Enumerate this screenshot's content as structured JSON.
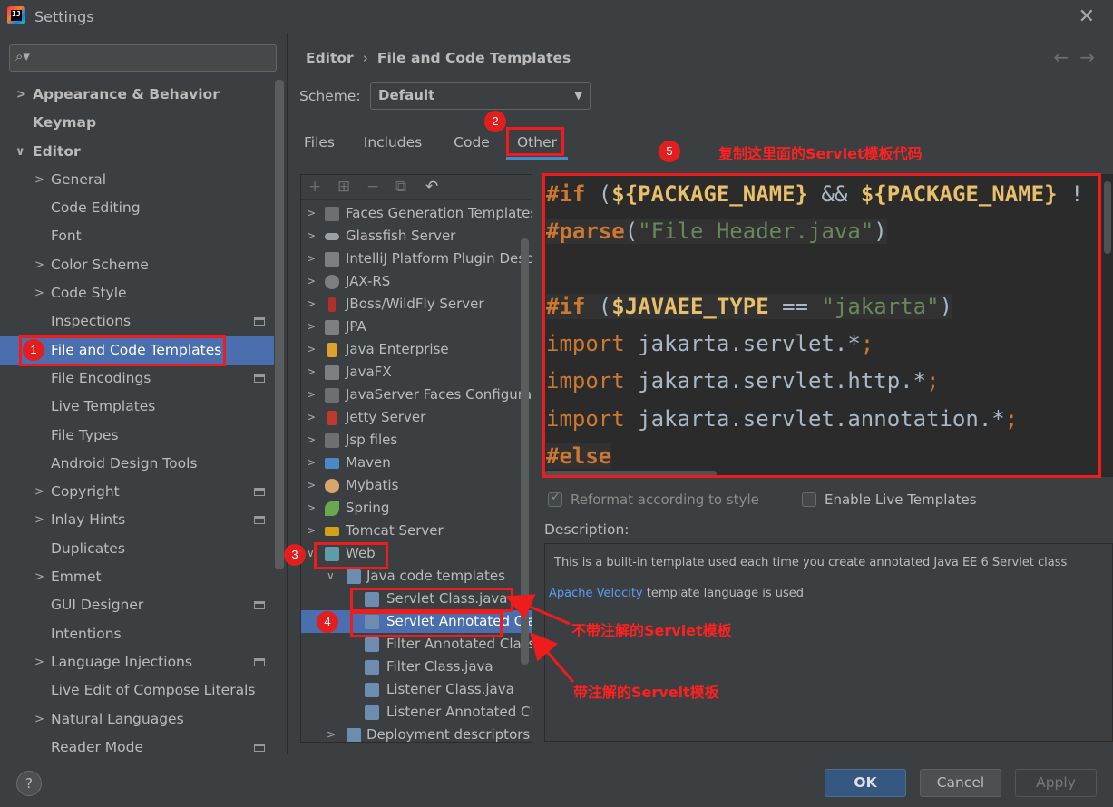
{
  "window": {
    "title": "Settings",
    "app_icon_text": "IJ"
  },
  "search": {
    "placeholder": ""
  },
  "sidebar": {
    "items": [
      {
        "label": "Appearance & Behavior",
        "expanded": false
      },
      {
        "label": "Keymap"
      },
      {
        "label": "Editor",
        "expanded": true
      },
      {
        "label": "General"
      },
      {
        "label": "Code Editing"
      },
      {
        "label": "Font"
      },
      {
        "label": "Color Scheme"
      },
      {
        "label": "Code Style"
      },
      {
        "label": "Inspections"
      },
      {
        "label": "File and Code Templates",
        "selected": true
      },
      {
        "label": "File Encodings"
      },
      {
        "label": "Live Templates"
      },
      {
        "label": "File Types"
      },
      {
        "label": "Android Design Tools"
      },
      {
        "label": "Copyright"
      },
      {
        "label": "Inlay Hints"
      },
      {
        "label": "Duplicates"
      },
      {
        "label": "Emmet"
      },
      {
        "label": "GUI Designer"
      },
      {
        "label": "Intentions"
      },
      {
        "label": "Language Injections"
      },
      {
        "label": "Live Edit of Compose Literals"
      },
      {
        "label": "Natural Languages"
      },
      {
        "label": "Reader Mode"
      }
    ]
  },
  "breadcrumb": {
    "parent": "Editor",
    "separator": "›",
    "current": "File and Code Templates"
  },
  "nav_arrows": "←→",
  "scheme": {
    "label": "Scheme:",
    "value": "Default"
  },
  "tabs": [
    "Files",
    "Includes",
    "Code",
    "Other"
  ],
  "toolbar": {
    "add": "+",
    "add_group": "⊞",
    "remove": "−",
    "copy": "⧉",
    "reset": "↶"
  },
  "tree": {
    "items": [
      {
        "label": "Faces Generation Templates"
      },
      {
        "label": "Glassfish Server"
      },
      {
        "label": "IntelliJ Platform Plugin Descr"
      },
      {
        "label": "JAX-RS"
      },
      {
        "label": "JBoss/WildFly Server"
      },
      {
        "label": "JPA"
      },
      {
        "label": "Java Enterprise"
      },
      {
        "label": "JavaFX"
      },
      {
        "label": "JavaServer Faces Configurati"
      },
      {
        "label": "Jetty Server"
      },
      {
        "label": "Jsp files"
      },
      {
        "label": "Maven"
      },
      {
        "label": "Mybatis"
      },
      {
        "label": "Spring"
      },
      {
        "label": "Tomcat Server"
      },
      {
        "label": "Web"
      },
      {
        "label": "Java code templates"
      },
      {
        "label": "Servlet Class.java"
      },
      {
        "label": "Servlet Annotated Cla"
      },
      {
        "label": "Filter Annotated Class"
      },
      {
        "label": "Filter Class.java"
      },
      {
        "label": "Listener Class.java"
      },
      {
        "label": "Listener Annotated Cl"
      },
      {
        "label": "Deployment descriptors"
      }
    ]
  },
  "code": {
    "line1_dir": "#if",
    "line1_rest_a": " (",
    "line1_var1": "${PACKAGE_NAME}",
    "line1_rest_b": " && ",
    "line1_var2": "${PACKAGE_NAME}",
    "line1_rest_c": " !",
    "line2_dir": "#parse",
    "line2_p1": "(",
    "line2_str": "\"File Header.java\"",
    "line2_p2": ")",
    "line4_dir": "#if",
    "line4_rest_a": " (",
    "line4_var": "$JAVAEE_TYPE",
    "line4_rest_b": " == ",
    "line4_str": "\"jakarta\"",
    "line4_rest_c": ")",
    "import_kw": "import",
    "line5_rest": " jakarta.servlet.*",
    "line6_rest": " jakarta.servlet.http.*",
    "line7_rest": " jakarta.servlet.annotation.*",
    "semicolon": ";",
    "line8_dir": "#else"
  },
  "options": {
    "reformat": "Reformat according to style",
    "live_templates": "Enable Live Templates"
  },
  "description": {
    "label": "Description:",
    "text": "This is a built-in template used each time you create annotated Java EE 6 Servlet class",
    "link": "Apache Velocity",
    "link_suffix": " template language is used"
  },
  "footer": {
    "help": "?",
    "ok": "OK",
    "cancel": "Cancel",
    "apply": "Apply"
  },
  "annotations": {
    "badge1": "1",
    "badge2": "2",
    "badge3": "3",
    "badge4": "4",
    "badge5": "5",
    "note5": "复制这里面的Servlet模板代码",
    "note_no_annotation": "不带注解的Servlet模板",
    "note_with_annotation": "带注解的Servelt模板",
    "color": "#ee1c1c"
  },
  "colors": {
    "accent": "#4b6eaf",
    "background": "#3c3f41",
    "editor_bg": "#2b2b2b",
    "link": "#589df6"
  }
}
